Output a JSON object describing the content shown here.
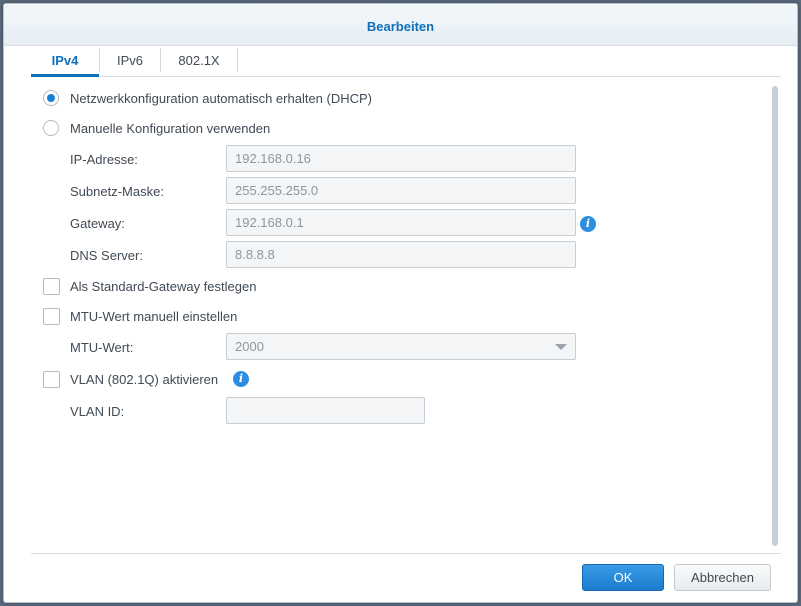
{
  "dialog": {
    "title": "Bearbeiten"
  },
  "tabs": [
    {
      "label": "IPv4",
      "active": true
    },
    {
      "label": "IPv6",
      "active": false
    },
    {
      "label": "802.1X",
      "active": false
    }
  ],
  "mode": {
    "dhcp_label": "Netzwerkkonfiguration automatisch erhalten (DHCP)",
    "dhcp_selected": true,
    "manual_label": "Manuelle Konfiguration verwenden",
    "manual_selected": false
  },
  "manual": {
    "ip_label": "IP-Adresse:",
    "ip_placeholder": "192.168.0.16",
    "subnet_label": "Subnetz-Maske:",
    "subnet_placeholder": "255.255.255.0",
    "gateway_label": "Gateway:",
    "gateway_placeholder": "192.168.0.1",
    "dns_label": "DNS Server:",
    "dns_placeholder": "8.8.8.8"
  },
  "options": {
    "default_gateway_label": "Als Standard-Gateway festlegen",
    "default_gateway_checked": false,
    "mtu_manual_label": "MTU-Wert manuell einstellen",
    "mtu_manual_checked": false,
    "mtu_label": "MTU-Wert:",
    "mtu_value": "2000",
    "vlan_label": "VLAN (802.1Q) aktivieren",
    "vlan_checked": false,
    "vlan_id_label": "VLAN ID:",
    "vlan_id_value": ""
  },
  "buttons": {
    "ok": "OK",
    "cancel": "Abbrechen"
  },
  "icons": {
    "info": "info-icon"
  },
  "colors": {
    "accent": "#0f6fb8",
    "primary_button": "#1b7ccf"
  }
}
